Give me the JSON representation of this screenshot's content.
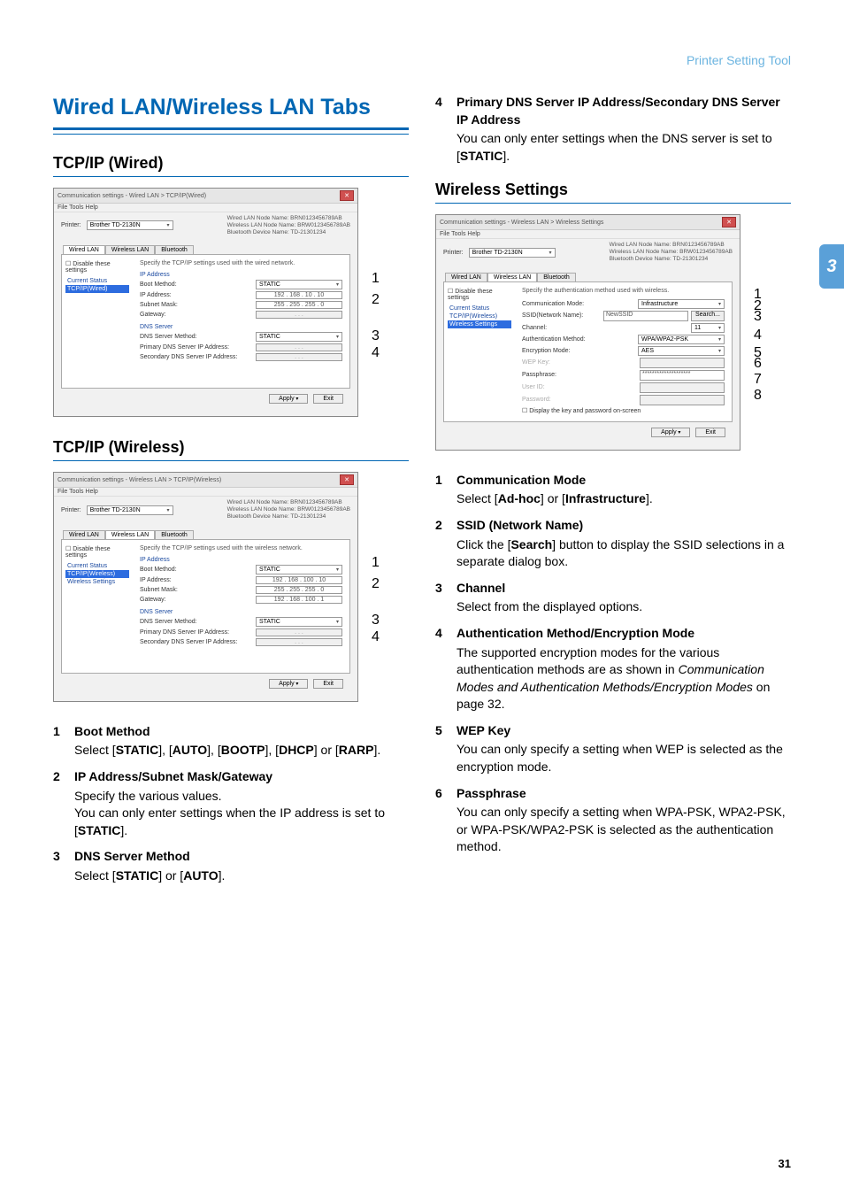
{
  "header": {
    "tool_name": "Printer Setting Tool"
  },
  "side_tab": "3",
  "page_number": "31",
  "main_heading": "Wired LAN/Wireless LAN Tabs",
  "sections": {
    "tcpip_wired": "TCP/IP (Wired)",
    "tcpip_wireless": "TCP/IP (Wireless)",
    "wireless_settings": "Wireless Settings"
  },
  "dialog": {
    "title_wired": "Communication settings - Wired LAN > TCP/IP(Wired)",
    "title_wireless_tcpip": "Communication settings - Wireless LAN > TCP/IP(Wireless)",
    "title_wireless_settings": "Communication settings - Wireless LAN > Wireless Settings",
    "menubar": "File   Tools   Help",
    "printer_label": "Printer:",
    "printer_value": "Brother TD-2130N",
    "node_wired": "Wired LAN Node Name: BRN0123456789AB",
    "node_wireless": "Wireless LAN Node Name: BRW0123456789AB",
    "node_bt": "Bluetooth Device Name: TD-21301234",
    "tabs": {
      "wired": "Wired LAN",
      "wireless": "Wireless LAN",
      "bluetooth": "Bluetooth"
    },
    "disable_chk": "Disable these settings",
    "side_items": {
      "current": "Current Status",
      "tcpip_wired": "TCP/IP(Wired)",
      "tcpip_wireless": "TCP/IP(Wireless)",
      "wireless_settings": "Wireless Settings"
    },
    "desc_wired": "Specify the TCP/IP settings used with the wired network.",
    "desc_wireless_tcp": "Specify the TCP/IP settings used with the wireless network.",
    "desc_wireless_set": "Specify the authentication method used with wireless.",
    "group_ip": "IP Address",
    "group_dns": "DNS Server",
    "fields": {
      "boot": "Boot Method:",
      "ip": "IP Address:",
      "subnet": "Subnet Mask:",
      "gateway": "Gateway:",
      "dns_method": "DNS Server Method:",
      "dns_primary": "Primary DNS Server IP Address:",
      "dns_secondary": "Secondary DNS Server IP Address:",
      "comm_mode": "Communication Mode:",
      "ssid": "SSID(Network Name):",
      "channel": "Channel:",
      "auth": "Authentication Method:",
      "enc": "Encryption Mode:",
      "wep": "WEP Key:",
      "pass": "Passphrase:",
      "userid": "User ID:",
      "password": "Password:",
      "display_kp": "Display the key and password on-screen"
    },
    "values": {
      "static": "STATIC",
      "ip_wired": "192 . 168 .  10 .  10",
      "subnet": "255 . 255 . 255 .   0",
      "gateway_wired": "   .    .    .   ",
      "ip_wless": "192 . 168 . 100 .  10",
      "gateway_wless": "192 . 168 . 100 .   1",
      "dns_blank": "   .    .    .   ",
      "infra": "Infrastructure",
      "ssid": "NewSSID",
      "channel": "11",
      "auth": "WPA/WPA2-PSK",
      "enc": "AES",
      "pass": "********************"
    },
    "buttons": {
      "apply": "Apply",
      "exit": "Exit",
      "search": "Search..."
    }
  },
  "left_list": {
    "i1": {
      "num": "1",
      "title": "Boot Method",
      "body_pre": "Select [",
      "s1": "STATIC",
      "m1": "], [",
      "s2": "AUTO",
      "m2": "], [",
      "s3": "BOOTP",
      "m3": "], [",
      "s4": "DHCP",
      "m4": "] or [",
      "s5": "RARP",
      "body_post": "]."
    },
    "i2": {
      "num": "2",
      "title": "IP Address/Subnet Mask/Gateway",
      "line1": "Specify the various values.",
      "line2a": "You can only enter settings when the IP address is set to [",
      "line2b": "STATIC",
      "line2c": "]."
    },
    "i3": {
      "num": "3",
      "title": "DNS Server Method",
      "body_pre": "Select [",
      "s1": "STATIC",
      "m1": "] or [",
      "s2": "AUTO",
      "body_post": "]."
    }
  },
  "right_top": {
    "i4": {
      "num": "4",
      "title": "Primary DNS Server IP Address/Secondary DNS Server IP Address",
      "line_a": "You can only enter settings when the DNS server is set to [",
      "line_b": "STATIC",
      "line_c": "]."
    }
  },
  "right_list": {
    "i1": {
      "num": "1",
      "title": "Communication Mode",
      "pre": "Select [",
      "s1": "Ad-hoc",
      "mid": "] or [",
      "s2": "Infrastructure",
      "post": "]."
    },
    "i2": {
      "num": "2",
      "title": "SSID (Network Name)",
      "pre": "Click the [",
      "s1": "Search",
      "post": "] button to display the SSID selections in a separate dialog box."
    },
    "i3": {
      "num": "3",
      "title": "Channel",
      "body": "Select from the displayed options."
    },
    "i4": {
      "num": "4",
      "title": "Authentication Method/Encryption Mode",
      "line1": "The supported encryption modes for the various authentication methods are as shown in ",
      "em": "Communication Modes and Authentication Methods/Encryption Modes",
      "line2": " on page 32."
    },
    "i5": {
      "num": "5",
      "title": "WEP Key",
      "body": "You can only specify a setting when WEP is selected as the encryption mode."
    },
    "i6": {
      "num": "6",
      "title": "Passphrase",
      "body": "You can only specify a setting when WPA-PSK, WPA2-PSK, or WPA-PSK/WPA2-PSK is selected as the authentication method."
    }
  }
}
